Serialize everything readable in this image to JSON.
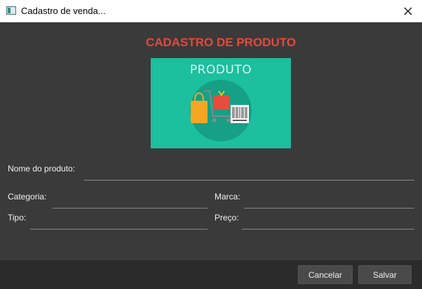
{
  "window": {
    "title": "Cadastro de venda..."
  },
  "form": {
    "heading": "CADASTRO DE PRODUTO",
    "banner_caption": "PRODUTO",
    "nome_label": "Nome do produto:",
    "categoria_label": "Categoria:",
    "marca_label": "Marca:",
    "tipo_label": "Tipo:",
    "preco_label": "Preço:",
    "nome_value": "",
    "categoria_value": "",
    "marca_value": "",
    "tipo_value": "",
    "preco_value": ""
  },
  "footer": {
    "cancel_label": "Cancelar",
    "save_label": "Salvar"
  },
  "colors": {
    "heading": "#e8483b",
    "banner_bg": "#1cbf9e",
    "window_bg": "#3a3a3a",
    "footer_bg": "#2b2b2b"
  }
}
